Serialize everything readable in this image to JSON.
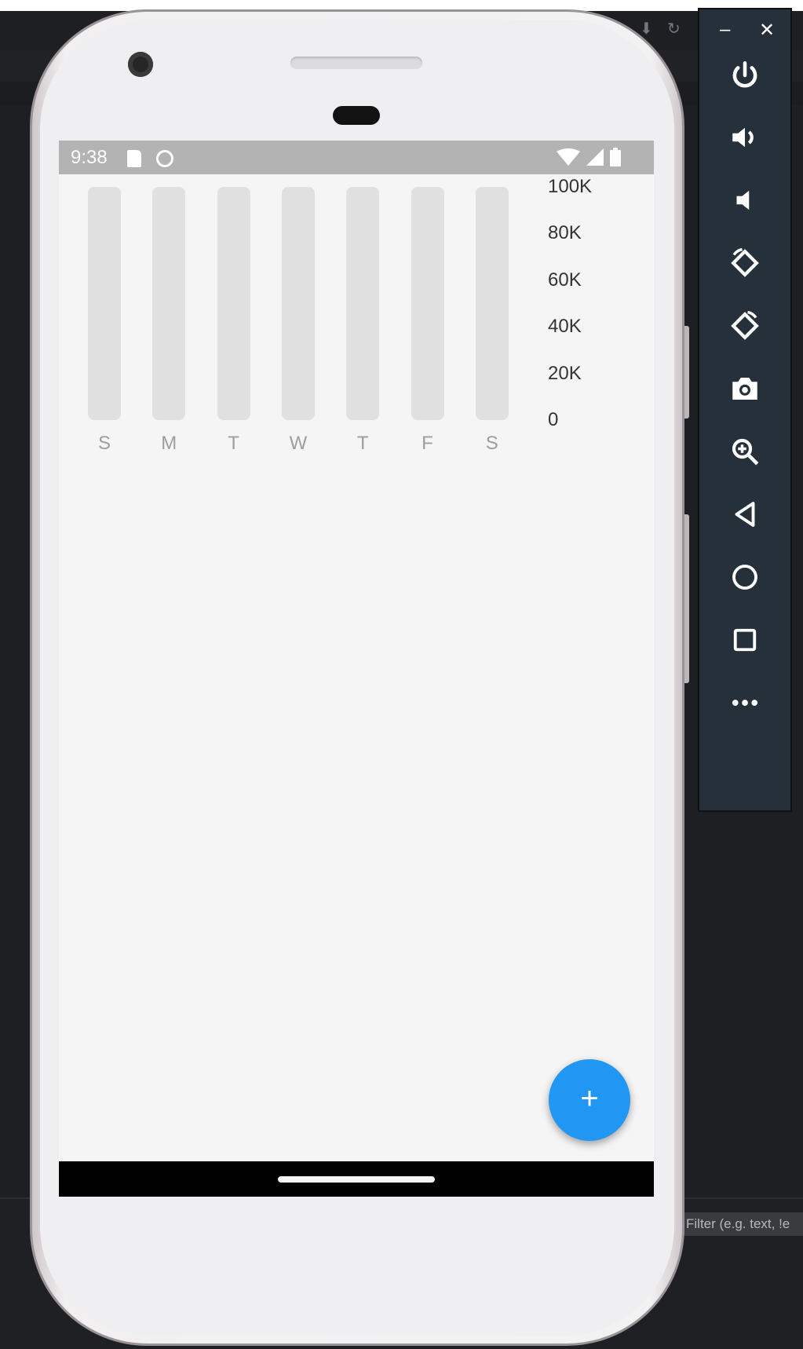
{
  "status_bar": {
    "time": "9:38"
  },
  "chart_data": {
    "type": "bar",
    "categories": [
      "S",
      "M",
      "T",
      "W",
      "T",
      "F",
      "S"
    ],
    "values": [
      0,
      0,
      0,
      0,
      0,
      0,
      0
    ],
    "y_ticks": [
      "100K",
      "80K",
      "60K",
      "40K",
      "20K",
      "0"
    ],
    "ylim": [
      0,
      100000
    ],
    "bar_background_color": "#e0e0e0"
  },
  "fab": {
    "label": "+",
    "color": "#2196f3"
  },
  "emulator": {
    "minimize": "–",
    "close": "✕",
    "buttons": [
      "power-icon",
      "volume-up-icon",
      "volume-down-icon",
      "rotate-left-icon",
      "rotate-right-icon",
      "camera-icon",
      "zoom-icon",
      "back-icon",
      "home-icon",
      "overview-icon",
      "more-icon"
    ]
  },
  "ide": {
    "filter_placeholder": "Filter (e.g. text, !e"
  }
}
